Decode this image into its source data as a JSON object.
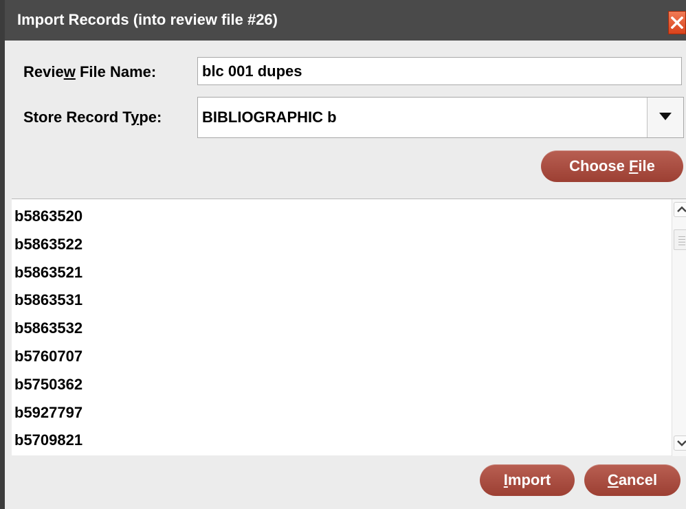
{
  "dialog": {
    "title": "Import Records (into review file #26)"
  },
  "form": {
    "review_file_label_pre": "Revie",
    "review_file_label_mnemonic": "w",
    "review_file_label_post": " File Name:",
    "review_file_value": "blc 001 dupes",
    "record_type_label_pre": "Store Record T",
    "record_type_label_mnemonic": "y",
    "record_type_label_post": "pe:",
    "record_type_value": "BIBLIOGRAPHIC  b"
  },
  "choose_file": {
    "label_pre": "Choose ",
    "label_mnemonic": "F",
    "label_post": "ile"
  },
  "records": [
    "b5863520",
    "b5863522",
    "b5863521",
    "b5863531",
    "b5863532",
    "b5760707",
    "b5750362",
    "b5927797",
    "b5709821"
  ],
  "buttons": {
    "import_mnemonic": "I",
    "import_rest": "mport",
    "cancel_mnemonic": "C",
    "cancel_rest": "ancel"
  },
  "icons": {
    "close": "close-x-icon",
    "dropdown": "triangle-down-icon",
    "scroll_up": "chevron-up-icon",
    "scroll_down": "chevron-down-icon"
  },
  "colors": {
    "titlebar": "#4a4a4a",
    "close_button": "#d9431b",
    "action_button": "#a84a3e"
  }
}
